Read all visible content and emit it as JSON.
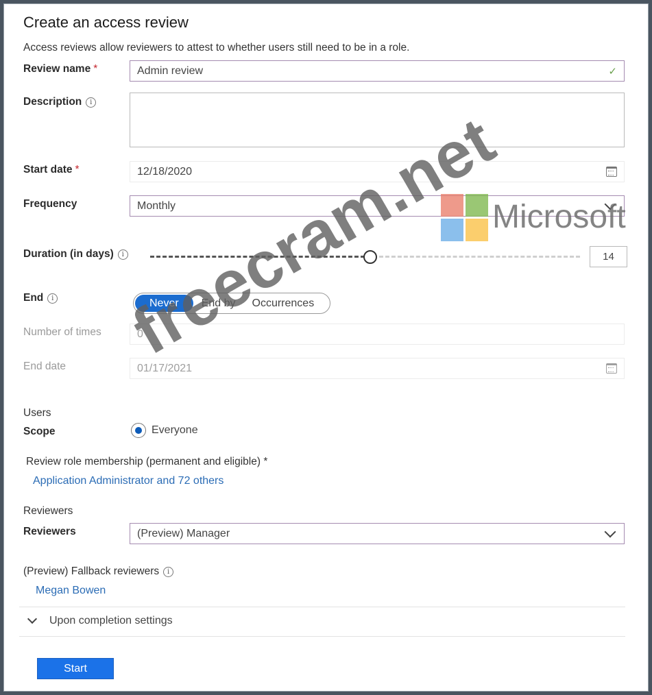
{
  "title": "Create an access review",
  "subtitle": "Access reviews allow reviewers to attest to whether users still need to be in a role.",
  "review_name": {
    "label": "Review name",
    "required": "*",
    "value": "Admin review"
  },
  "description": {
    "label": "Description",
    "value": ""
  },
  "start_date": {
    "label": "Start date",
    "required": "*",
    "value": "12/18/2020"
  },
  "frequency": {
    "label": "Frequency",
    "value": "Monthly"
  },
  "duration": {
    "label": "Duration (in days)",
    "value": "14",
    "slider_fraction": 0.51
  },
  "end": {
    "label": "End",
    "options": [
      "Never",
      "End by",
      "Occurrences"
    ],
    "selected": "Never"
  },
  "number_of_times": {
    "label": "Number of times",
    "value": "0"
  },
  "end_date": {
    "label": "End date",
    "value": "01/17/2021"
  },
  "users": {
    "section": "Users",
    "scope_label": "Scope",
    "scope_option": "Everyone",
    "membership_label": "Review role membership (permanent and eligible) *",
    "membership_link": "Application Administrator and 72 others"
  },
  "reviewers": {
    "section": "Reviewers",
    "label": "Reviewers",
    "value": "(Preview) Manager",
    "fallback_label": "(Preview) Fallback reviewers",
    "fallback_link": "Megan Bowen"
  },
  "completion": {
    "label": "Upon completion settings"
  },
  "start_button": "Start",
  "watermark": {
    "text": "freecram.net",
    "brand": "Microsoft"
  },
  "colors": {
    "accent": "#1b6ccf",
    "button": "#1b72e8",
    "link": "#2b6cb5",
    "required": "#c4262e"
  },
  "info_icon_glyph": "i"
}
